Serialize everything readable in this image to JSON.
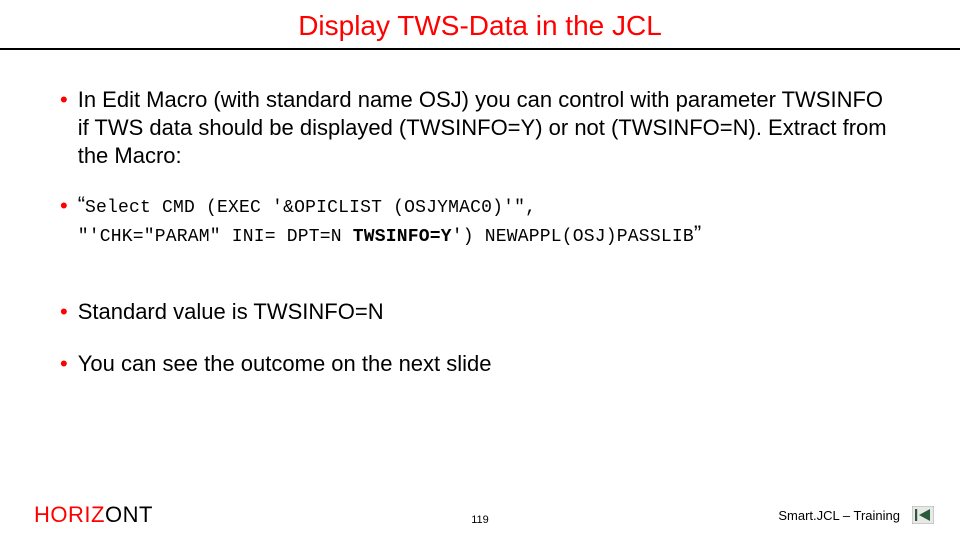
{
  "title": "Display TWS-Data in the JCL",
  "bullets": {
    "b1": "In Edit Macro (with standard name OSJ) you can control with parameter TWSINFO if TWS data should be displayed (TWSINFO=Y) or not (TWSINFO=N). Extract from the Macro:",
    "code_quote_open": "“",
    "code_line1": "Select CMD (EXEC '&OPICLIST (OSJYMAC0)'\",",
    "code_line2_prefix": "\"'CHK=\"PARAM\" INI= DPT=N ",
    "code_line2_bold": "TWSINFO=Y",
    "code_line2_suffix": "') NEWAPPL(OSJ)PASSLIB",
    "code_quote_close": "”",
    "b3": "Standard value is TWSINFO=N",
    "b4": "You can see the outcome on the next slide"
  },
  "footer": {
    "brand_accent": "HORIZ",
    "brand_rest": "ONT",
    "page": "119",
    "course": "Smart.JCL – Training"
  }
}
